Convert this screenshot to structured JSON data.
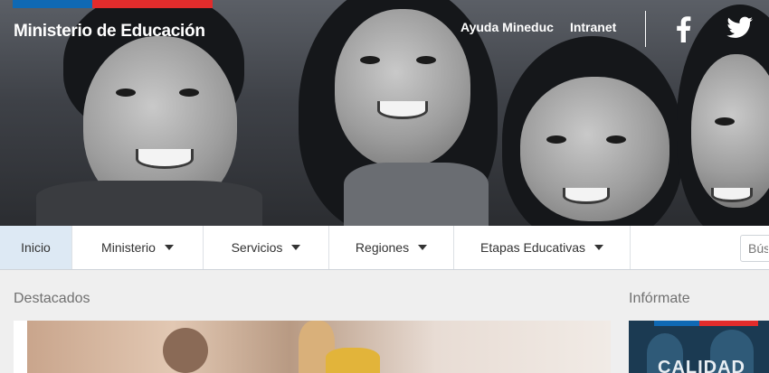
{
  "header": {
    "site_title": "Ministerio de Educación",
    "top_links": [
      "Ayuda Mineduc",
      "Intranet"
    ],
    "social": [
      "facebook-icon",
      "twitter-icon"
    ],
    "flag_colors": {
      "blue": "#0f69b4",
      "red": "#e22c2c"
    }
  },
  "nav": {
    "items": [
      {
        "label": "Inicio",
        "has_dropdown": false,
        "active": true
      },
      {
        "label": "Ministerio",
        "has_dropdown": true
      },
      {
        "label": "Servicios",
        "has_dropdown": true
      },
      {
        "label": "Regiones",
        "has_dropdown": true
      },
      {
        "label": "Etapas Educativas",
        "has_dropdown": true
      }
    ],
    "search_placeholder": "Bús"
  },
  "main": {
    "featured_title": "Destacados",
    "sidebar_title": "Infórmate",
    "sidebar_promo_text": "CALIDAD"
  }
}
